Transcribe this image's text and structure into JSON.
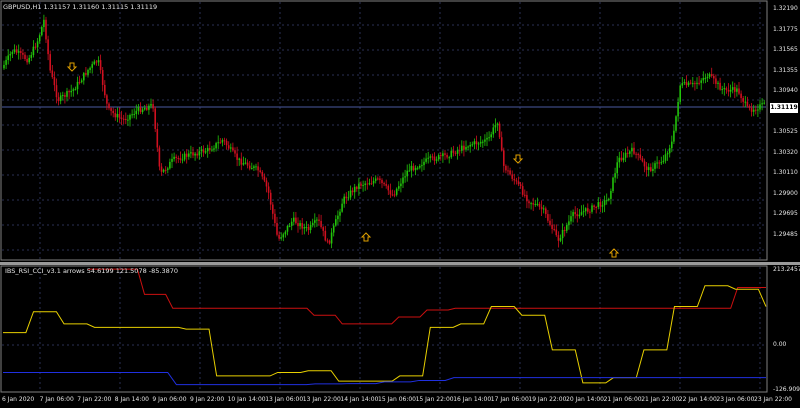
{
  "chart_title": "GBPUSD,H1  1.31157 1.31160 1.31115 1.31119",
  "indicator_title": "IBS_RSI_CCI_v3.1 arrows 54.6199 121.5078 -85.3870",
  "price_axis": [
    "1.32190",
    "1.31775",
    "1.31565",
    "1.31355",
    "1.30940",
    "1.30735",
    "1.30525",
    "1.30320",
    "1.30110",
    "1.29900",
    "1.29695",
    "1.29485"
  ],
  "current_price": "1.31119",
  "indicator_axis": [
    "213.2457",
    "0.00",
    "-126.9091"
  ],
  "time_axis": [
    "6 Jan 2020",
    "7 Jan 06:00",
    "7 Jan 22:00",
    "8 Jan 14:00",
    "9 Jan 06:00",
    "9 Jan 22:00",
    "10 Jan 14:00",
    "13 Jan 06:00",
    "13 Jan 22:00",
    "14 Jan 14:00",
    "15 Jan 06:00",
    "15 Jan 22:00",
    "16 Jan 14:00",
    "17 Jan 06:00",
    "19 Jan 22:00",
    "20 Jan 14:00",
    "21 Jan 06:00",
    "21 Jan 22:00",
    "22 Jan 14:00",
    "23 Jan 06:00",
    "23 Jan 22:00"
  ],
  "colors": {
    "bull": "#22c40a",
    "bear": "#d01020",
    "wick": "#c0c0c0",
    "arrow": "#e0a000",
    "red_line": "#cc1010",
    "yellow_line": "#e8d000",
    "blue_line": "#2030e0",
    "grid": "#2a2f55"
  },
  "chart_data": [
    {
      "type": "candlestick",
      "title": "GBPUSD,H1",
      "ylim": [
        1.29485,
        1.3219
      ],
      "arrows": [
        {
          "dir": "down",
          "index": 0.09
        },
        {
          "dir": "up",
          "index": 0.475
        },
        {
          "dir": "down",
          "index": 0.675
        },
        {
          "dir": "up",
          "index": 0.8
        }
      ]
    },
    {
      "type": "line",
      "title": "IBS_RSI_CCI_v3.1 arrows",
      "ylim": [
        -126.9091,
        213.2457
      ],
      "series": [
        {
          "name": "red",
          "values": [
            213,
            213,
            140,
            100,
            100,
            100,
            100,
            100,
            80,
            55,
            55,
            75,
            95,
            100,
            100,
            100,
            100,
            100,
            100,
            100,
            100,
            100,
            100,
            160,
            160
          ]
        },
        {
          "name": "yellow",
          "values": [
            30,
            90,
            55,
            45,
            45,
            45,
            40,
            -95,
            -95,
            -85,
            -80,
            -110,
            -110,
            -95,
            45,
            55,
            105,
            80,
            -20,
            -115,
            -100,
            -20,
            105,
            165,
            155,
            105
          ]
        },
        {
          "name": "blue",
          "values": [
            -85,
            -85,
            -85,
            -85,
            -85,
            -120,
            -120,
            -120,
            -120,
            -118,
            -117,
            -112,
            -108,
            -100,
            -100,
            -100,
            -100,
            -100,
            -100,
            -100,
            -100,
            -100,
            -100
          ]
        }
      ]
    }
  ]
}
